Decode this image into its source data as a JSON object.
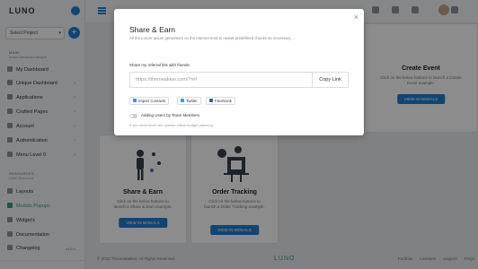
{
  "app": {
    "brand": "LUNO"
  },
  "sidebar": {
    "project_select": "Select Project",
    "main_section": "MAIN",
    "main_sub": "Unique dashboard designs",
    "items": [
      {
        "label": "My Dashboard",
        "caret": ""
      },
      {
        "label": "Unique Dashboard",
        "caret": "›"
      },
      {
        "label": "Applications",
        "caret": "›"
      },
      {
        "label": "Crafted Pages",
        "caret": "›"
      },
      {
        "label": "Account",
        "caret": "›"
      },
      {
        "label": "Authentication",
        "caret": "›"
      },
      {
        "label": "Menu Level 0",
        "caret": "›"
      }
    ],
    "resources_section": "RESOURCES",
    "resources_sub": "LUNO Resources",
    "resource_items": [
      {
        "label": "Layouts",
        "badge": ""
      },
      {
        "label": "Modals Popups",
        "badge": ""
      },
      {
        "label": "Widget's",
        "badge": ""
      },
      {
        "label": "Documentation",
        "badge": ""
      },
      {
        "label": "Changelog",
        "badge": "v1.0.0"
      }
    ]
  },
  "cards": {
    "create_event": {
      "title": "Create Event",
      "desc": "Click on the below buttons to launch a Create Event example.",
      "button": "VIEW IN MODALS"
    },
    "share_earn": {
      "title": "Share & Earn",
      "desc": "Click on the below buttons to launch a Share & Earn example.",
      "button": "VIEW IN MODALS"
    },
    "order_tracking": {
      "title": "Order Tracking",
      "desc": "Click on the below buttons to launch a Order Tracking example.",
      "button": "VIEW IN MODALS"
    }
  },
  "footer": {
    "copyright": "© 2022 ThemeMakker. All Rights Reserved.",
    "logo": "LUNO",
    "links": [
      "Portfolio",
      "Licenses",
      "Support",
      "FAQs"
    ]
  },
  "modal": {
    "title": "Share & Earn",
    "subtitle": "All the Lorem Ipsum generators on the Internet tend to repeat predefined chunks as necessary",
    "share_label": "Share my referral link with friends",
    "referral_link": "https://themeakker.com/?ref",
    "copy_button": "Copy Link",
    "socials": [
      {
        "label": "Import Contacts",
        "color": "#4285f4"
      },
      {
        "label": "Twitter",
        "color": "#1da1f2"
      },
      {
        "label": "Facebook",
        "color": "#3b5998"
      }
    ],
    "toggle_label": "Adding Users by Team Members",
    "permission_note": "If you need more info, please check budget planning"
  }
}
